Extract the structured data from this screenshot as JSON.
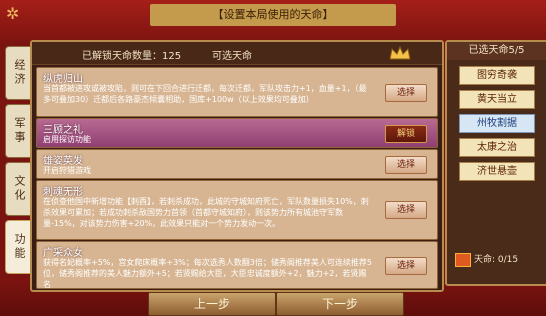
{
  "title": "【设置本局使用的天命】",
  "side_tabs": [
    {
      "label": "经济",
      "active": false
    },
    {
      "label": "军事",
      "active": false
    },
    {
      "label": "文化",
      "active": false
    },
    {
      "label": "功能",
      "active": true
    }
  ],
  "header": {
    "unlocked_count_label": "已解锁天命数量：125",
    "available_label": "可选天命"
  },
  "cards": [
    {
      "name": "纵虎归山",
      "desc": "当首都被进攻或被攻陷，则可在下回合进行迁都，每次迁都，军队攻击力+1，血量+1，（最多可叠加30）迁都后各路豪杰倾囊相助，国库+100w（以上效果均可叠加）",
      "action": "选择",
      "locked": false
    },
    {
      "name": "三顾之礼",
      "desc": "启用探访功能",
      "action": "解锁",
      "locked": true
    },
    {
      "name": "雄姿英发",
      "desc": "开启狩猎游戏",
      "action": "选择",
      "locked": false
    },
    {
      "name": "刺魂无形",
      "desc": "在侦查他国中新增功能【刺酉】，若刺杀成功，此城的守城知府死亡，军队数量损失10%，刺杀效果可累加；若成功刺杀敌国势力首领（首都守城知府），则该势力所有城池守军数量-15%，对该势力伤害+20%，此效果只能对一个势力发动一次。",
      "action": "选择",
      "locked": false
    },
    {
      "name": "广采众女",
      "desc": "获得名妃概率+5%，宫女爬床概率+3%；每次选秀人数翻3倍；储秀阁推荐美人可连续推荐5位，储秀阁推荐的美人魅力额外+5；若贤赐给大臣，大臣忠诚度额外+2，魅力+2，若贤赐名",
      "action": "选择",
      "locked": false
    }
  ],
  "right_panel": {
    "title": "已选天命5/5",
    "slots": [
      {
        "label": "图穷奇袭",
        "blue": false
      },
      {
        "label": "黄天当立",
        "blue": false
      },
      {
        "label": "州牧割据",
        "blue": true
      },
      {
        "label": "太康之治",
        "blue": false
      },
      {
        "label": "济世悬壶",
        "blue": false
      }
    ],
    "footer": "天命: 0/15"
  },
  "nav": {
    "prev": "上一步",
    "next": "下一步"
  }
}
